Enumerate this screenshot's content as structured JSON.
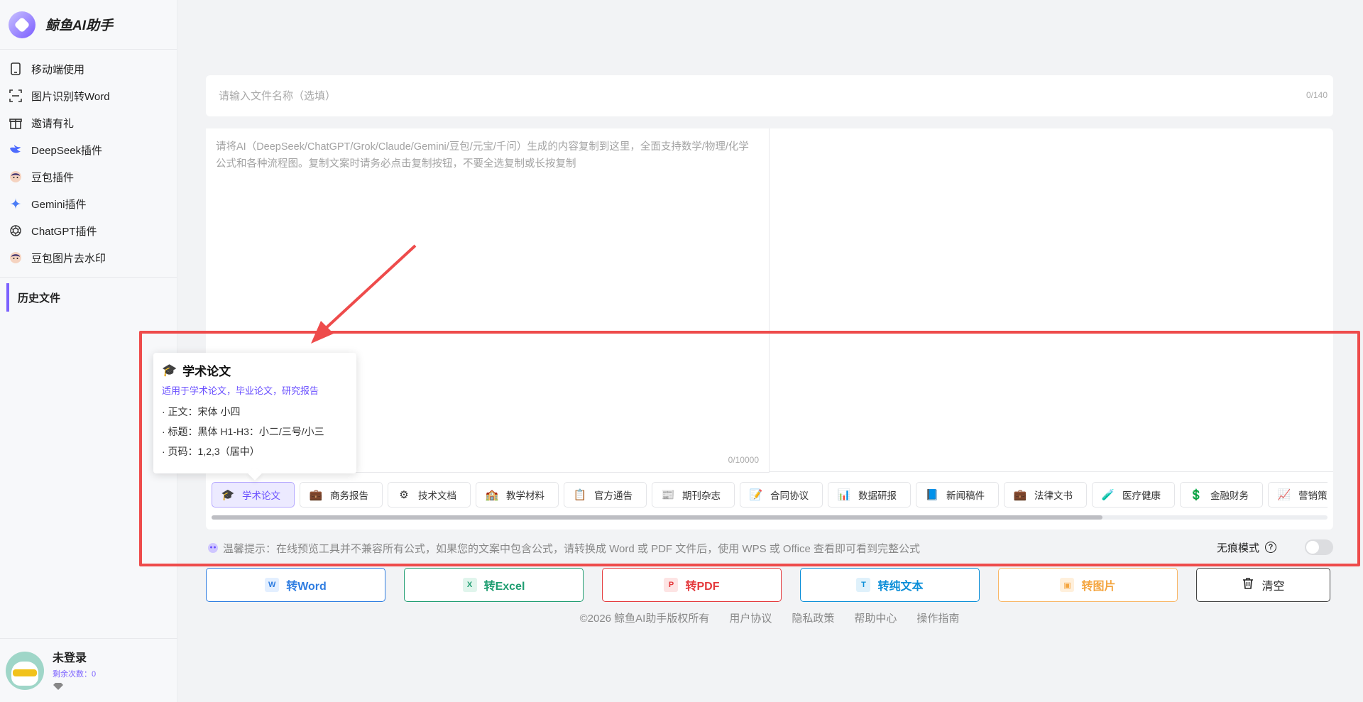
{
  "brand": {
    "name": "鲸鱼AI助手"
  },
  "sidebar": {
    "items": [
      {
        "label": "移动端使用",
        "icon": "phone-icon"
      },
      {
        "label": "图片识别转Word",
        "icon": "scan-icon"
      },
      {
        "label": "邀请有礼",
        "icon": "gift-icon"
      },
      {
        "label": "DeepSeek插件",
        "icon": "deepseek-icon"
      },
      {
        "label": "豆包插件",
        "icon": "doubao-icon"
      },
      {
        "label": "Gemini插件",
        "icon": "gemini-icon"
      },
      {
        "label": "ChatGPT插件",
        "icon": "chatgpt-icon"
      },
      {
        "label": "豆包图片去水印",
        "icon": "doubao-watermark-icon"
      }
    ],
    "history_label": "历史文件"
  },
  "user": {
    "name": "未登录",
    "remaining": "剩余次数：0"
  },
  "filename": {
    "placeholder": "请输入文件名称（选填）",
    "count": "0/140"
  },
  "editor": {
    "placeholder": "请将AI（DeepSeek/ChatGPT/Grok/Claude/Gemini/豆包/元宝/千问）生成的内容复制到这里，全面支持数学/物理/化学公式和各种流程图。复制文案时请务必点击复制按钮，不要全选复制或长按复制",
    "count": "0/10000"
  },
  "templates": [
    {
      "label": "学术论文",
      "icon": "🎓",
      "active": true
    },
    {
      "label": "商务报告",
      "icon": "💼"
    },
    {
      "label": "技术文档",
      "icon": "⚙"
    },
    {
      "label": "教学材料",
      "icon": "🏫"
    },
    {
      "label": "官方通告",
      "icon": "📋"
    },
    {
      "label": "期刊杂志",
      "icon": "📰"
    },
    {
      "label": "合同协议",
      "icon": "📝"
    },
    {
      "label": "数据研报",
      "icon": "📊"
    },
    {
      "label": "新闻稿件",
      "icon": "📘"
    },
    {
      "label": "法律文书",
      "icon": "💼"
    },
    {
      "label": "医疗健康",
      "icon": "🧪"
    },
    {
      "label": "金融财务",
      "icon": "💲"
    },
    {
      "label": "营销策",
      "icon": "📈"
    }
  ],
  "tooltip": {
    "title": "学术论文",
    "subtitle": "适用于学术论文，毕业论文，研究报告",
    "lines": [
      "· 正文：宋体 小四",
      "· 标题：黑体 H1-H3：小二/三号/小三",
      "· 页码：1,2,3（居中）"
    ]
  },
  "hint": {
    "text": "温馨提示：在线预览工具并不兼容所有公式，如果您的文案中包含公式，请转换成 Word 或 PDF 文件后，使用 WPS 或 Office 查看即可看到完整公式",
    "incognito_label": "无痕模式",
    "incognito_on": false
  },
  "actions": {
    "word": "转Word",
    "excel": "转Excel",
    "pdf": "转PDF",
    "text": "转纯文本",
    "image": "转图片",
    "clear": "清空"
  },
  "footer": {
    "copyright": "©2026 鲸鱼AI助手版权所有",
    "links": [
      "用户协议",
      "隐私政策",
      "帮助中心",
      "操作指南"
    ]
  },
  "colors": {
    "accent": "#7b61ff",
    "annotation": "#ee4b4b"
  }
}
